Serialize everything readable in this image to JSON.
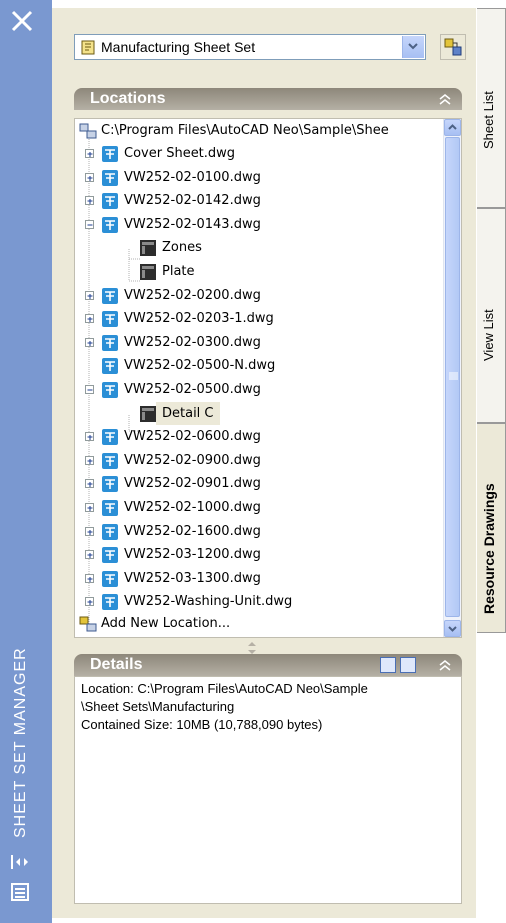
{
  "window": {
    "title": "SHEET SET MANAGER"
  },
  "sheet_set": {
    "selected": "Manufacturing Sheet Set"
  },
  "locations": {
    "header": "Locations",
    "root": "C:\\Program Files\\AutoCAD Neo\\Sample\\Shee",
    "items": [
      {
        "label": "Cover Sheet.dwg"
      },
      {
        "label": "VW252-02-0100.dwg"
      },
      {
        "label": "VW252-02-0142.dwg"
      },
      {
        "label": "VW252-02-0143.dwg"
      },
      {
        "label": "Zones"
      },
      {
        "label": "Plate"
      },
      {
        "label": "VW252-02-0200.dwg"
      },
      {
        "label": "VW252-02-0203-1.dwg"
      },
      {
        "label": "VW252-02-0300.dwg"
      },
      {
        "label": "VW252-02-0500-N.dwg"
      },
      {
        "label": "VW252-02-0500.dwg"
      },
      {
        "label": "Detail C"
      },
      {
        "label": "VW252-02-0600.dwg"
      },
      {
        "label": "VW252-02-0900.dwg"
      },
      {
        "label": "VW252-02-0901.dwg"
      },
      {
        "label": "VW252-02-1000.dwg"
      },
      {
        "label": "VW252-02-1600.dwg"
      },
      {
        "label": "VW252-03-1200.dwg"
      },
      {
        "label": "VW252-03-1300.dwg"
      },
      {
        "label": "VW252-Washing-Unit.dwg"
      }
    ],
    "add_new": "Add New Location..."
  },
  "details": {
    "header": "Details",
    "lines": [
      "Location: C:\\Program Files\\AutoCAD Neo\\Sample",
      "\\Sheet Sets\\Manufacturing",
      "Contained Size: 10MB (10,788,090 bytes)"
    ]
  },
  "tabs": [
    {
      "label": "Sheet List"
    },
    {
      "label": "View List"
    },
    {
      "label": "Resource Drawings"
    }
  ],
  "colors": {
    "title_bar": "#7a98d0",
    "panel": "#ece9d8",
    "section_header": "#8d877a",
    "sheet_icon": "#2b8fd6"
  }
}
